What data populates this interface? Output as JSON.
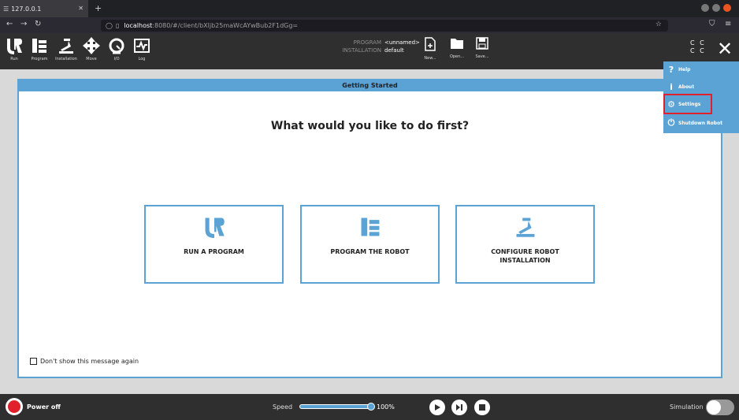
{
  "browser": {
    "tab_title": "127.0.0.1",
    "url_host": "localhost",
    "url_path": ":8080/#/client/bXljb25maWcAYwBub2F1dGg="
  },
  "header": {
    "tabs": [
      {
        "label": "Run"
      },
      {
        "label": "Program"
      },
      {
        "label": "Installation"
      },
      {
        "label": "Move"
      },
      {
        "label": "I/O"
      },
      {
        "label": "Log"
      }
    ],
    "program_label": "PROGRAM",
    "program_value": "<unnamed>",
    "installation_label": "INSTALLATION",
    "installation_value": "default",
    "new_label": "New...",
    "open_label": "Open...",
    "save_label": "Save...",
    "cc_text_1": "C C",
    "cc_text_2": "C C"
  },
  "menu": {
    "items": [
      {
        "label": "Help"
      },
      {
        "label": "About"
      },
      {
        "label": "Settings"
      },
      {
        "label": "Shutdown Robot"
      }
    ]
  },
  "dialog": {
    "title": "Getting Started",
    "question": "What would you like to do first?",
    "choices": [
      {
        "label": "RUN A PROGRAM"
      },
      {
        "label": "PROGRAM THE ROBOT"
      },
      {
        "label": "CONFIGURE ROBOT INSTALLATION"
      }
    ],
    "dont_show": "Don't show this message again"
  },
  "footer": {
    "power_label": "Power off",
    "speed_label": "Speed",
    "speed_value": "100%",
    "speed_fraction": 1.0,
    "simulation_label": "Simulation"
  },
  "colors": {
    "accent": "#5ba3d5",
    "highlight": "#e0202a",
    "header_bg": "#2f2f2f"
  }
}
